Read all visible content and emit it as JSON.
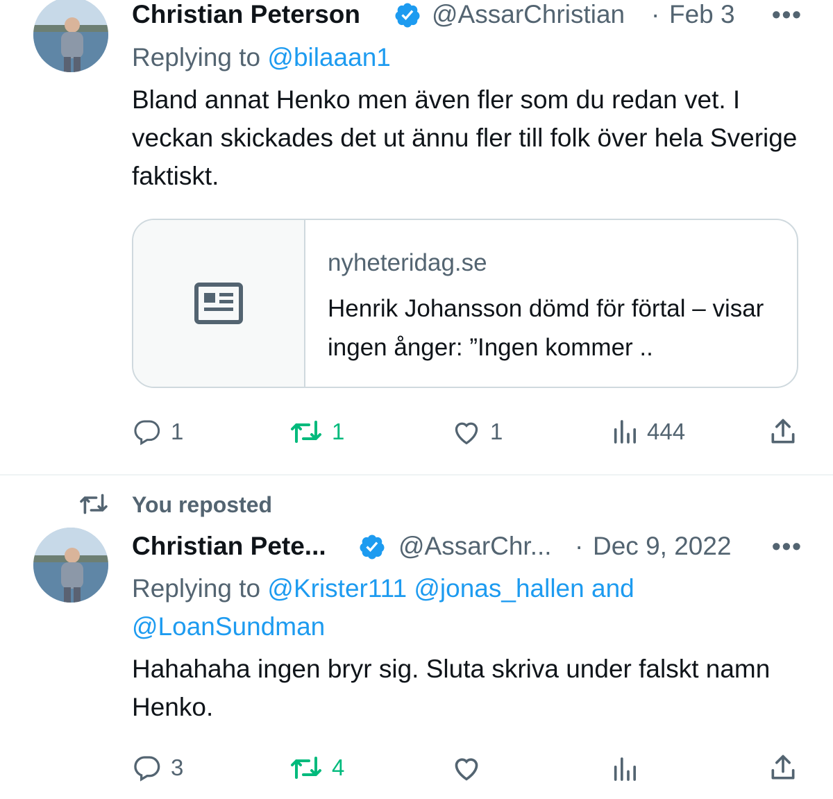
{
  "tweets": [
    {
      "name": "Christian Peterson",
      "handle": "@AssarChristian",
      "separator": "·",
      "date": "Feb 3",
      "replying_prefix": "Replying to",
      "replying_to": "@bilaaan1",
      "text": "Bland annat Henko men även fler som du redan vet. I veckan skickades det ut ännu fler till folk över hela Sverige faktiskt.",
      "card": {
        "domain": "nyheteridag.se",
        "title": "Henrik Johansson dömd för förtal – visar ingen ånger: ”Ingen kommer .."
      },
      "actions": {
        "replies": "1",
        "reposts": "1",
        "likes": "1",
        "views": "444"
      }
    },
    {
      "repost_label": "You reposted",
      "name": "Christian Pete...",
      "handle": "@AssarChr...",
      "separator": "·",
      "date": "Dec 9, 2022",
      "replying_prefix": "Replying to",
      "replying_line1": "@Krister111 @jonas_hallen and",
      "replying_line2": "@LoanSundman",
      "text": "Hahahaha ingen bryr sig. Sluta skriva under falskt namn Henko.",
      "actions": {
        "replies": "3",
        "reposts": "4"
      }
    }
  ],
  "colors": {
    "accent": "#1d9bf0",
    "repost": "#00ba7c",
    "muted": "#536471"
  },
  "icons": [
    "verified-badge-icon",
    "more-icon",
    "reply-icon",
    "repost-icon",
    "like-icon",
    "views-icon",
    "share-icon",
    "news-article-icon"
  ]
}
